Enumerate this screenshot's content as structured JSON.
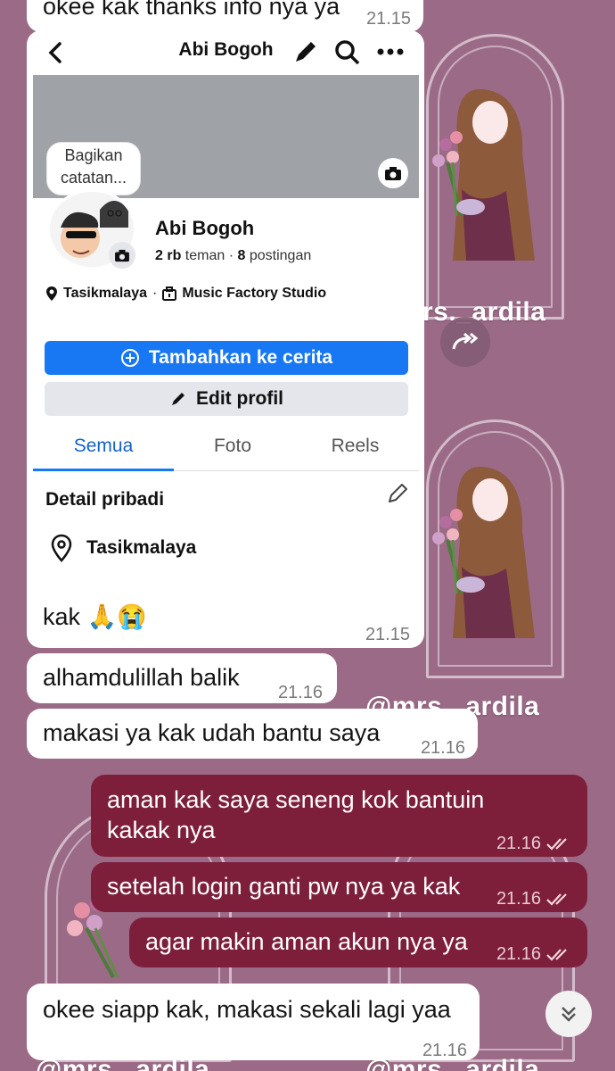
{
  "messages": {
    "m0": {
      "text": "okee kak thanks info nya ya",
      "time": "21.15"
    },
    "m1": {
      "text": "kak 🙏😭",
      "time": "21.15"
    },
    "m2": {
      "text": "alhamdulillah balik",
      "time": "21.16"
    },
    "m3": {
      "text": "makasi ya kak udah bantu saya",
      "time": "21.16"
    },
    "m4": {
      "text_line1": "aman kak saya seneng kok bantuin",
      "text_line2": "kakak nya",
      "time": "21.16"
    },
    "m5": {
      "text": "setelah login ganti pw nya ya kak",
      "time": "21.16"
    },
    "m6": {
      "text": "agar makin aman akun nya ya",
      "time": "21.16"
    },
    "m7": {
      "text": "okee siapp kak, makasi sekali lagi yaa",
      "time": "21.16"
    }
  },
  "facebook_profile": {
    "header_title": "Abi Bogoh",
    "note_line1": "Bagikan",
    "note_line2": "catatan...",
    "name": "Abi Bogoh",
    "friends_count": "2 rb",
    "friends_label": "teman",
    "separator": "·",
    "posts_count": "8",
    "posts_label": "postingan",
    "location": "Tasikmalaya",
    "workplace": "Music Factory Studio",
    "add_story_label": "Tambahkan ke cerita",
    "edit_profile_label": "Edit profil",
    "tabs": [
      "Semua",
      "Foto",
      "Reels"
    ],
    "details_title": "Detail pribadi",
    "details_location": "Tasikmalaya"
  },
  "wallpaper": {
    "watermark": "@mrs._ardila",
    "watermark_partial": "rs._ardila"
  },
  "colors": {
    "background": "#9b6a87",
    "outgoing_bubble": "#7d1f3b",
    "incoming_bubble": "#ffffff",
    "facebook_blue": "#1877f2"
  }
}
